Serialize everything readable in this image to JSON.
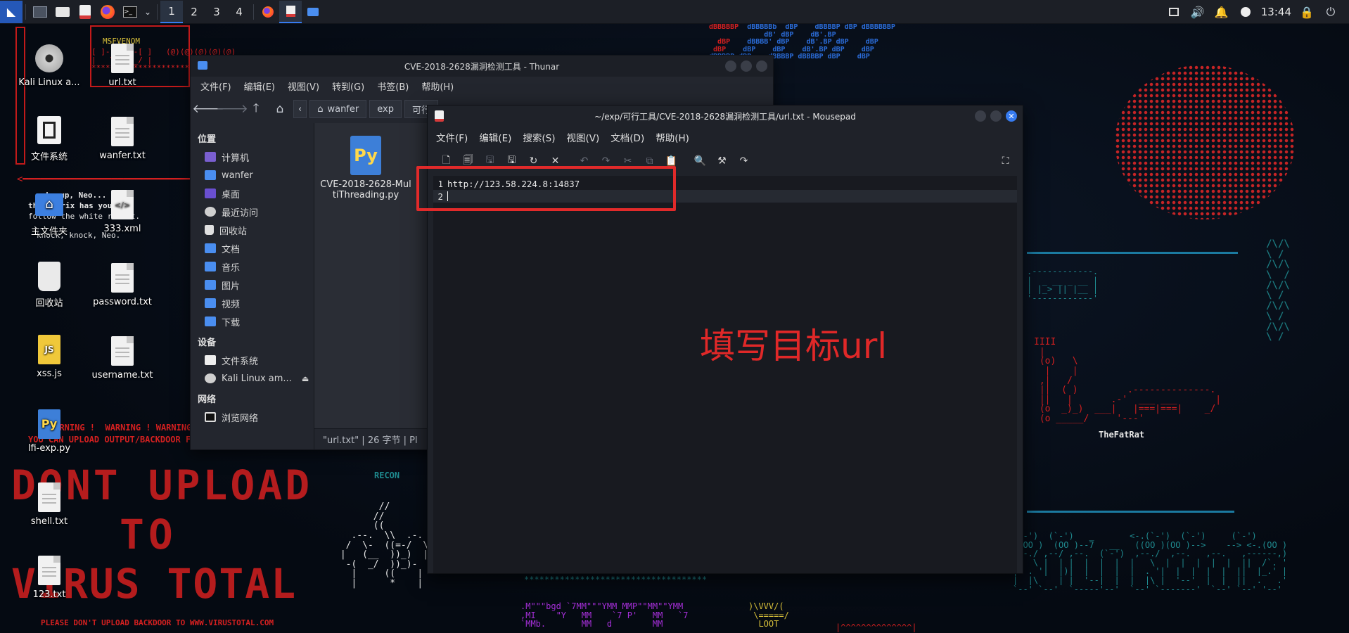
{
  "taskbar": {
    "workspaces": [
      "1",
      "2",
      "3",
      "4"
    ],
    "clock": "13:44",
    "icons": [
      "kali-menu-icon",
      "show-desktop-icon",
      "files-icon",
      "text-editor-icon",
      "firefox-icon",
      "terminal-icon",
      "chevron-down-icon",
      "firefox-task-icon",
      "mousepad-task-icon",
      "thunar-task-icon",
      "screen-icon",
      "volume-icon",
      "notification-icon",
      "network-icon",
      "lock-icon",
      "power-icon"
    ]
  },
  "desktop": {
    "icons": [
      {
        "label": "Kali Linux a...",
        "type": "disc"
      },
      {
        "label": "url.txt",
        "type": "text"
      },
      {
        "label": "文件系统",
        "type": "drive"
      },
      {
        "label": "wanfer.txt",
        "type": "text"
      },
      {
        "label": "主文件夹",
        "type": "home"
      },
      {
        "label": "333.xml",
        "type": "xml"
      },
      {
        "label": "回收站",
        "type": "trash"
      },
      {
        "label": "password.txt",
        "type": "text"
      },
      {
        "label": "xss.js",
        "type": "js"
      },
      {
        "label": "username.txt",
        "type": "text"
      },
      {
        "label": "lfi-exp.py",
        "type": "python"
      },
      {
        "label": "shell.txt",
        "type": "text"
      },
      {
        "label": "123.txt",
        "type": "text"
      }
    ]
  },
  "wallpaper": {
    "msfvenom": "MSFVENOM",
    "matrix1": "wake up, Neo...",
    "matrix2": "the matrix has you",
    "matrix3": "follow the white rabbit.",
    "matrix4": "knock, knock, Neo.",
    "warning1": "WARNING !  WARNING ! WARNING !",
    "warning2": "YOU CAN UPLOAD OUTPUT/BACKDOOR FILE",
    "dont1": "DONT UPLOAD",
    "dont2": "TO",
    "dont3": "VIRUS TOTAL",
    "please": "PLEASE DON'T UPLOAD BACKDOOR TO WWW.VIRUSTOTAL.COM",
    "recon": "RECON",
    "fatrat": "TheFatRat",
    "loot": "LOOT"
  },
  "thunar": {
    "title": "CVE-2018-2628漏洞检测工具 - Thunar",
    "menu": [
      "文件(F)",
      "编辑(E)",
      "视图(V)",
      "转到(G)",
      "书签(B)",
      "帮助(H)"
    ],
    "breadcrumbs": [
      "wanfer",
      "exp",
      "可行"
    ],
    "sidebar": {
      "places_header": "位置",
      "places": [
        "计算机",
        "wanfer",
        "桌面",
        "最近访问",
        "回收站",
        "文档",
        "音乐",
        "图片",
        "视频",
        "下载"
      ],
      "devices_header": "设备",
      "devices": [
        "文件系统",
        "Kali Linux am..."
      ],
      "network_header": "网络",
      "network": [
        "浏览网络"
      ]
    },
    "file": {
      "name": "CVE-2018-2628-MultiThreading.py"
    },
    "status": "\"url.txt\" | 26 字节 | Pl"
  },
  "mousepad": {
    "title": "~/exp/可行工具/CVE-2018-2628漏洞检测工具/url.txt - Mousepad",
    "menu": [
      "文件(F)",
      "编辑(E)",
      "搜索(S)",
      "视图(V)",
      "文档(D)",
      "帮助(H)"
    ],
    "lines": [
      {
        "num": "1",
        "text": "http://123.58.224.8:14837"
      },
      {
        "num": "2",
        "text": ""
      }
    ]
  },
  "annotation": "填写目标url",
  "colors": {
    "accent": "#367bf0",
    "annotation_red": "#e02828",
    "panel": "#1c1f26"
  }
}
